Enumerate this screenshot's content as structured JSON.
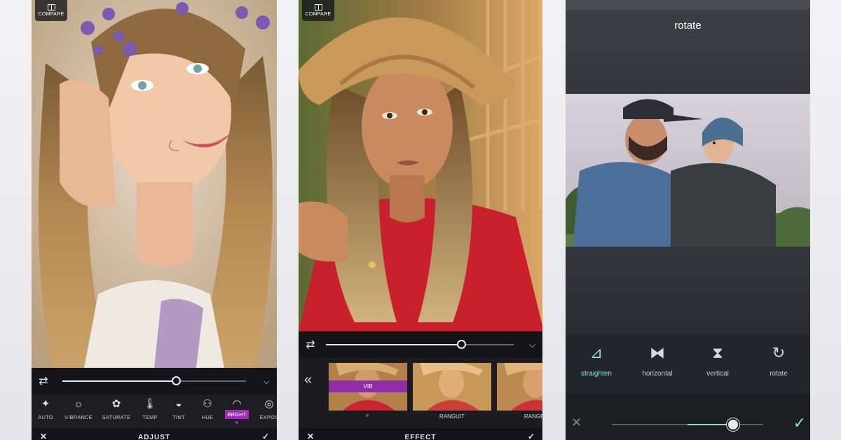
{
  "screens": [
    {
      "compare_label": "COMPARE",
      "slider_level": 0.62,
      "tools": [
        {
          "label": "AUTO",
          "icon": "magic-wand-icon"
        },
        {
          "label": "VIBRANCE",
          "icon": "sun-icon"
        },
        {
          "label": "SATURATE",
          "icon": "saturate-icon"
        },
        {
          "label": "TEMP",
          "icon": "thermometer-icon"
        },
        {
          "label": "TINT",
          "icon": "tint-icon"
        },
        {
          "label": "HUE",
          "icon": "hue-icon"
        },
        {
          "label": "BRGHT",
          "icon": "brightness-icon",
          "active": true
        },
        {
          "label": "EXPOS",
          "icon": "exposure-icon"
        }
      ],
      "bottom_title": "ADJUST"
    },
    {
      "compare_label": "COMPARE",
      "slider_level": 0.72,
      "effects": [
        {
          "label": "",
          "tag": "VIB",
          "active": true
        },
        {
          "label": "RANGUIT"
        },
        {
          "label": "RANGER"
        }
      ],
      "bottom_title": "EFFECT"
    },
    {
      "title": "rotate",
      "transforms": [
        {
          "label": "straighten",
          "icon": "straighten-icon",
          "active": true
        },
        {
          "label": "horizontal",
          "icon": "flip-horizontal-icon"
        },
        {
          "label": "vertical",
          "icon": "flip-vertical-icon"
        },
        {
          "label": "rotate",
          "icon": "rotate-icon"
        }
      ],
      "slider_level": 0.8
    }
  ],
  "colors": {
    "accent_purple": "#a12fb5",
    "accent_teal": "#8fe0d4"
  }
}
